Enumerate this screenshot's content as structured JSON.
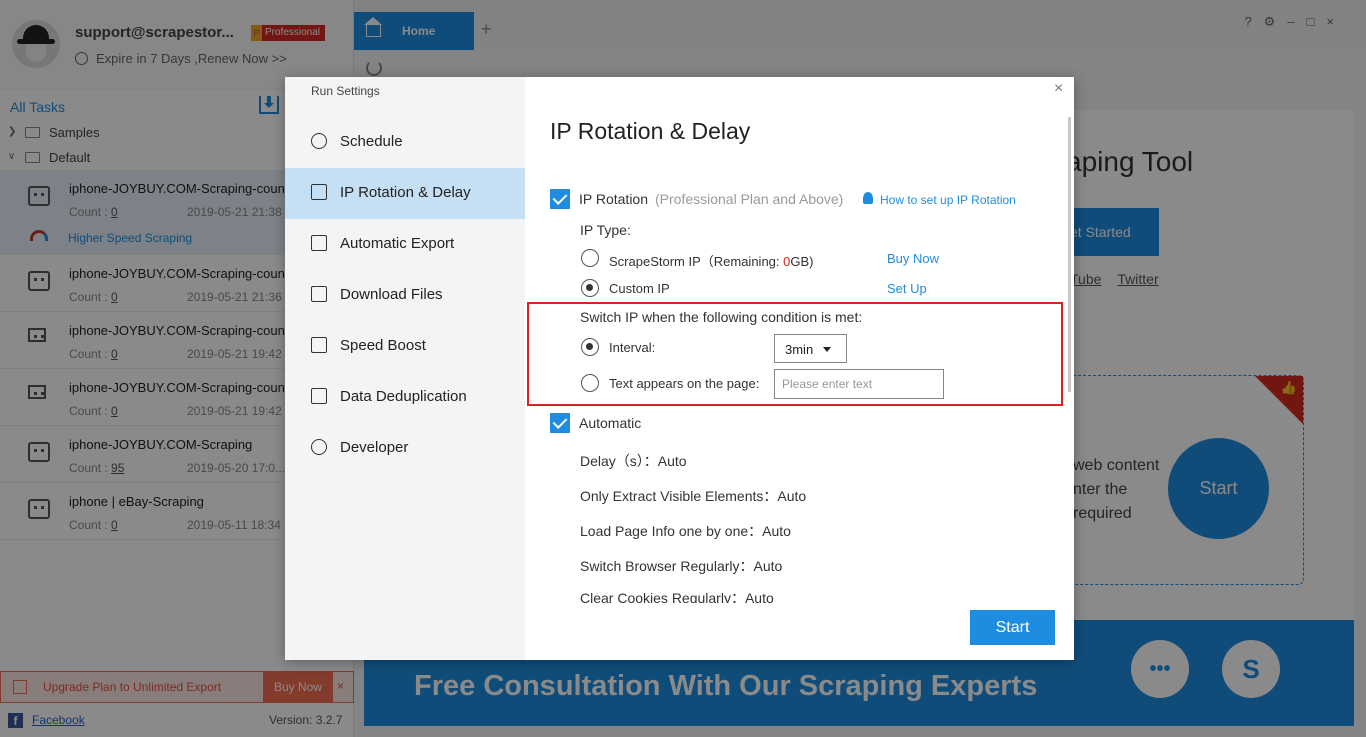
{
  "app": {
    "user_email": "support@scrapestor...",
    "plan_badge": "Professional",
    "expire_text": "Expire in 7 Days ,Renew Now >>",
    "all_tasks": "All Tasks",
    "folders": [
      "Samples",
      "Default"
    ],
    "tasks": [
      {
        "name": "iphone-JOYBUY.COM-Scraping-counter",
        "count_label": "Count : ",
        "count": "0",
        "date": "2019-05-21 21:38",
        "speed": "Higher Speed Scraping"
      },
      {
        "name": "iphone-JOYBUY.COM-Scraping-counter",
        "count_label": "Count : ",
        "count": "0",
        "date": "2019-05-21 21:36"
      },
      {
        "name": "iphone-JOYBUY.COM-Scraping-counter",
        "count_label": "Count : ",
        "count": "0",
        "date": "2019-05-21 19:42"
      },
      {
        "name": "iphone-JOYBUY.COM-Scraping-counter",
        "count_label": "Count : ",
        "count": "0",
        "date": "2019-05-21 19:42"
      },
      {
        "name": "iphone-JOYBUY.COM-Scraping",
        "count_label": "Count : ",
        "count": "95",
        "date": "2019-05-20 17:0..."
      },
      {
        "name": "iphone | eBay-Scraping",
        "count_label": "Count : ",
        "count": "0",
        "date": "2019-05-11 18:34"
      }
    ],
    "upgrade_text": "Upgrade Plan to Unlimited Export",
    "upgrade_buy": "Buy Now",
    "upgrade_close": "×",
    "facebook": "Facebook",
    "version": "Version: 3.2.7",
    "tab_home": "Home",
    "tab_add": "+",
    "window_controls": "?⚙–□×",
    "home_title": "aping Tool",
    "home_get_started": "et Started",
    "home_links": [
      "Tube",
      "Twitter"
    ],
    "home_card_text": [
      "web content",
      "nter the",
      "required"
    ],
    "home_start": "Start",
    "banner_text": "Free Consultation With Our Scraping Experts",
    "banner_chat": "•••",
    "banner_skype": "S",
    "card_thumb": "👍"
  },
  "dialog": {
    "title": "Run Settings",
    "close": "×",
    "nav": [
      {
        "label": "Schedule",
        "icon": "alarm-clock-icon"
      },
      {
        "label": "IP Rotation & Delay",
        "icon": "ip-settings-icon"
      },
      {
        "label": "Automatic Export",
        "icon": "export-icon"
      },
      {
        "label": "Download Files",
        "icon": "download-file-icon"
      },
      {
        "label": "Speed Boost",
        "icon": "speed-chart-icon"
      },
      {
        "label": "Data Deduplication",
        "icon": "deduplicate-icon"
      },
      {
        "label": "Developer",
        "icon": "gear-icon"
      }
    ],
    "active_nav": "IP Rotation & Delay",
    "heading": "IP Rotation & Delay",
    "ip_rotation": {
      "checked": true,
      "label": "IP Rotation",
      "note": "(Professional Plan and Above)",
      "help_link": "How to set up IP Rotation"
    },
    "ip_type_label": "IP Type:",
    "ip_options": [
      {
        "label_prefix": "ScrapeStorm IP（Remaining: ",
        "remaining_value": "0",
        "label_suffix": "GB)",
        "action": "Buy Now",
        "selected": false
      },
      {
        "label": "Custom IP",
        "action": "Set Up",
        "selected": true
      }
    ],
    "switch_condition_label": "Switch IP when the following condition is met:",
    "interval": {
      "label": "Interval:",
      "value": "3min",
      "selected": true
    },
    "text_appears": {
      "label": "Text appears on the page:",
      "placeholder": "Please enter text",
      "selected": false
    },
    "automatic": {
      "checked": true,
      "label": "Automatic"
    },
    "auto_settings": [
      "Delay（s）：Auto",
      "Only Extract Visible Elements：Auto",
      "Load Page Info one by one：Auto",
      "Switch Browser Regularly：Auto",
      "Clear Cookies Regularly：Auto"
    ],
    "start_button": "Start",
    "accent_color": "#1e8de0",
    "highlight_color": "#e02020"
  }
}
